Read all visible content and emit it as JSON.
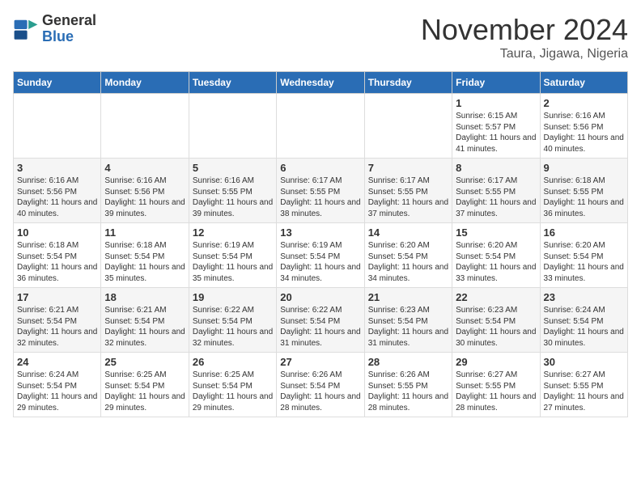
{
  "logo": {
    "general": "General",
    "blue": "Blue"
  },
  "title": "November 2024",
  "location": "Taura, Jigawa, Nigeria",
  "days_header": [
    "Sunday",
    "Monday",
    "Tuesday",
    "Wednesday",
    "Thursday",
    "Friday",
    "Saturday"
  ],
  "weeks": [
    [
      {
        "day": "",
        "info": ""
      },
      {
        "day": "",
        "info": ""
      },
      {
        "day": "",
        "info": ""
      },
      {
        "day": "",
        "info": ""
      },
      {
        "day": "",
        "info": ""
      },
      {
        "day": "1",
        "info": "Sunrise: 6:15 AM\nSunset: 5:57 PM\nDaylight: 11 hours and 41 minutes."
      },
      {
        "day": "2",
        "info": "Sunrise: 6:16 AM\nSunset: 5:56 PM\nDaylight: 11 hours and 40 minutes."
      }
    ],
    [
      {
        "day": "3",
        "info": "Sunrise: 6:16 AM\nSunset: 5:56 PM\nDaylight: 11 hours and 40 minutes."
      },
      {
        "day": "4",
        "info": "Sunrise: 6:16 AM\nSunset: 5:56 PM\nDaylight: 11 hours and 39 minutes."
      },
      {
        "day": "5",
        "info": "Sunrise: 6:16 AM\nSunset: 5:55 PM\nDaylight: 11 hours and 39 minutes."
      },
      {
        "day": "6",
        "info": "Sunrise: 6:17 AM\nSunset: 5:55 PM\nDaylight: 11 hours and 38 minutes."
      },
      {
        "day": "7",
        "info": "Sunrise: 6:17 AM\nSunset: 5:55 PM\nDaylight: 11 hours and 37 minutes."
      },
      {
        "day": "8",
        "info": "Sunrise: 6:17 AM\nSunset: 5:55 PM\nDaylight: 11 hours and 37 minutes."
      },
      {
        "day": "9",
        "info": "Sunrise: 6:18 AM\nSunset: 5:55 PM\nDaylight: 11 hours and 36 minutes."
      }
    ],
    [
      {
        "day": "10",
        "info": "Sunrise: 6:18 AM\nSunset: 5:54 PM\nDaylight: 11 hours and 36 minutes."
      },
      {
        "day": "11",
        "info": "Sunrise: 6:18 AM\nSunset: 5:54 PM\nDaylight: 11 hours and 35 minutes."
      },
      {
        "day": "12",
        "info": "Sunrise: 6:19 AM\nSunset: 5:54 PM\nDaylight: 11 hours and 35 minutes."
      },
      {
        "day": "13",
        "info": "Sunrise: 6:19 AM\nSunset: 5:54 PM\nDaylight: 11 hours and 34 minutes."
      },
      {
        "day": "14",
        "info": "Sunrise: 6:20 AM\nSunset: 5:54 PM\nDaylight: 11 hours and 34 minutes."
      },
      {
        "day": "15",
        "info": "Sunrise: 6:20 AM\nSunset: 5:54 PM\nDaylight: 11 hours and 33 minutes."
      },
      {
        "day": "16",
        "info": "Sunrise: 6:20 AM\nSunset: 5:54 PM\nDaylight: 11 hours and 33 minutes."
      }
    ],
    [
      {
        "day": "17",
        "info": "Sunrise: 6:21 AM\nSunset: 5:54 PM\nDaylight: 11 hours and 32 minutes."
      },
      {
        "day": "18",
        "info": "Sunrise: 6:21 AM\nSunset: 5:54 PM\nDaylight: 11 hours and 32 minutes."
      },
      {
        "day": "19",
        "info": "Sunrise: 6:22 AM\nSunset: 5:54 PM\nDaylight: 11 hours and 32 minutes."
      },
      {
        "day": "20",
        "info": "Sunrise: 6:22 AM\nSunset: 5:54 PM\nDaylight: 11 hours and 31 minutes."
      },
      {
        "day": "21",
        "info": "Sunrise: 6:23 AM\nSunset: 5:54 PM\nDaylight: 11 hours and 31 minutes."
      },
      {
        "day": "22",
        "info": "Sunrise: 6:23 AM\nSunset: 5:54 PM\nDaylight: 11 hours and 30 minutes."
      },
      {
        "day": "23",
        "info": "Sunrise: 6:24 AM\nSunset: 5:54 PM\nDaylight: 11 hours and 30 minutes."
      }
    ],
    [
      {
        "day": "24",
        "info": "Sunrise: 6:24 AM\nSunset: 5:54 PM\nDaylight: 11 hours and 29 minutes."
      },
      {
        "day": "25",
        "info": "Sunrise: 6:25 AM\nSunset: 5:54 PM\nDaylight: 11 hours and 29 minutes."
      },
      {
        "day": "26",
        "info": "Sunrise: 6:25 AM\nSunset: 5:54 PM\nDaylight: 11 hours and 29 minutes."
      },
      {
        "day": "27",
        "info": "Sunrise: 6:26 AM\nSunset: 5:54 PM\nDaylight: 11 hours and 28 minutes."
      },
      {
        "day": "28",
        "info": "Sunrise: 6:26 AM\nSunset: 5:55 PM\nDaylight: 11 hours and 28 minutes."
      },
      {
        "day": "29",
        "info": "Sunrise: 6:27 AM\nSunset: 5:55 PM\nDaylight: 11 hours and 28 minutes."
      },
      {
        "day": "30",
        "info": "Sunrise: 6:27 AM\nSunset: 5:55 PM\nDaylight: 11 hours and 27 minutes."
      }
    ]
  ]
}
